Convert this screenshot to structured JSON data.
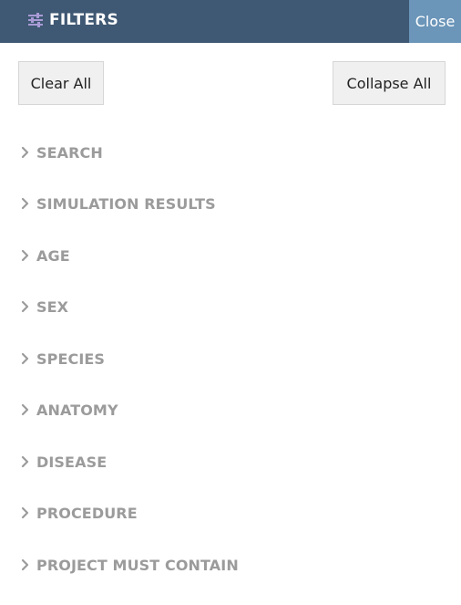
{
  "header": {
    "title": "FILTERS",
    "close_label": "Close",
    "icon": "sliders-icon"
  },
  "actions": {
    "clear_all_label": "Clear All",
    "collapse_all_label": "Collapse All"
  },
  "filters": [
    {
      "label": "SEARCH",
      "icon": "chevron-right-icon"
    },
    {
      "label": "SIMULATION RESULTS",
      "icon": "chevron-right-icon"
    },
    {
      "label": "AGE",
      "icon": "chevron-right-icon"
    },
    {
      "label": "SEX",
      "icon": "chevron-right-icon"
    },
    {
      "label": "SPECIES",
      "icon": "chevron-right-icon"
    },
    {
      "label": "ANATOMY",
      "icon": "chevron-right-icon"
    },
    {
      "label": "DISEASE",
      "icon": "chevron-right-icon"
    },
    {
      "label": "PROCEDURE",
      "icon": "chevron-right-icon"
    },
    {
      "label": "PROJECT MUST CONTAIN",
      "icon": "chevron-right-icon"
    }
  ],
  "colors": {
    "header_bg": "#3f5873",
    "close_bg": "#6b95b9",
    "filter_label": "#9b9b9b",
    "icon_accent": "#a99bd6"
  }
}
